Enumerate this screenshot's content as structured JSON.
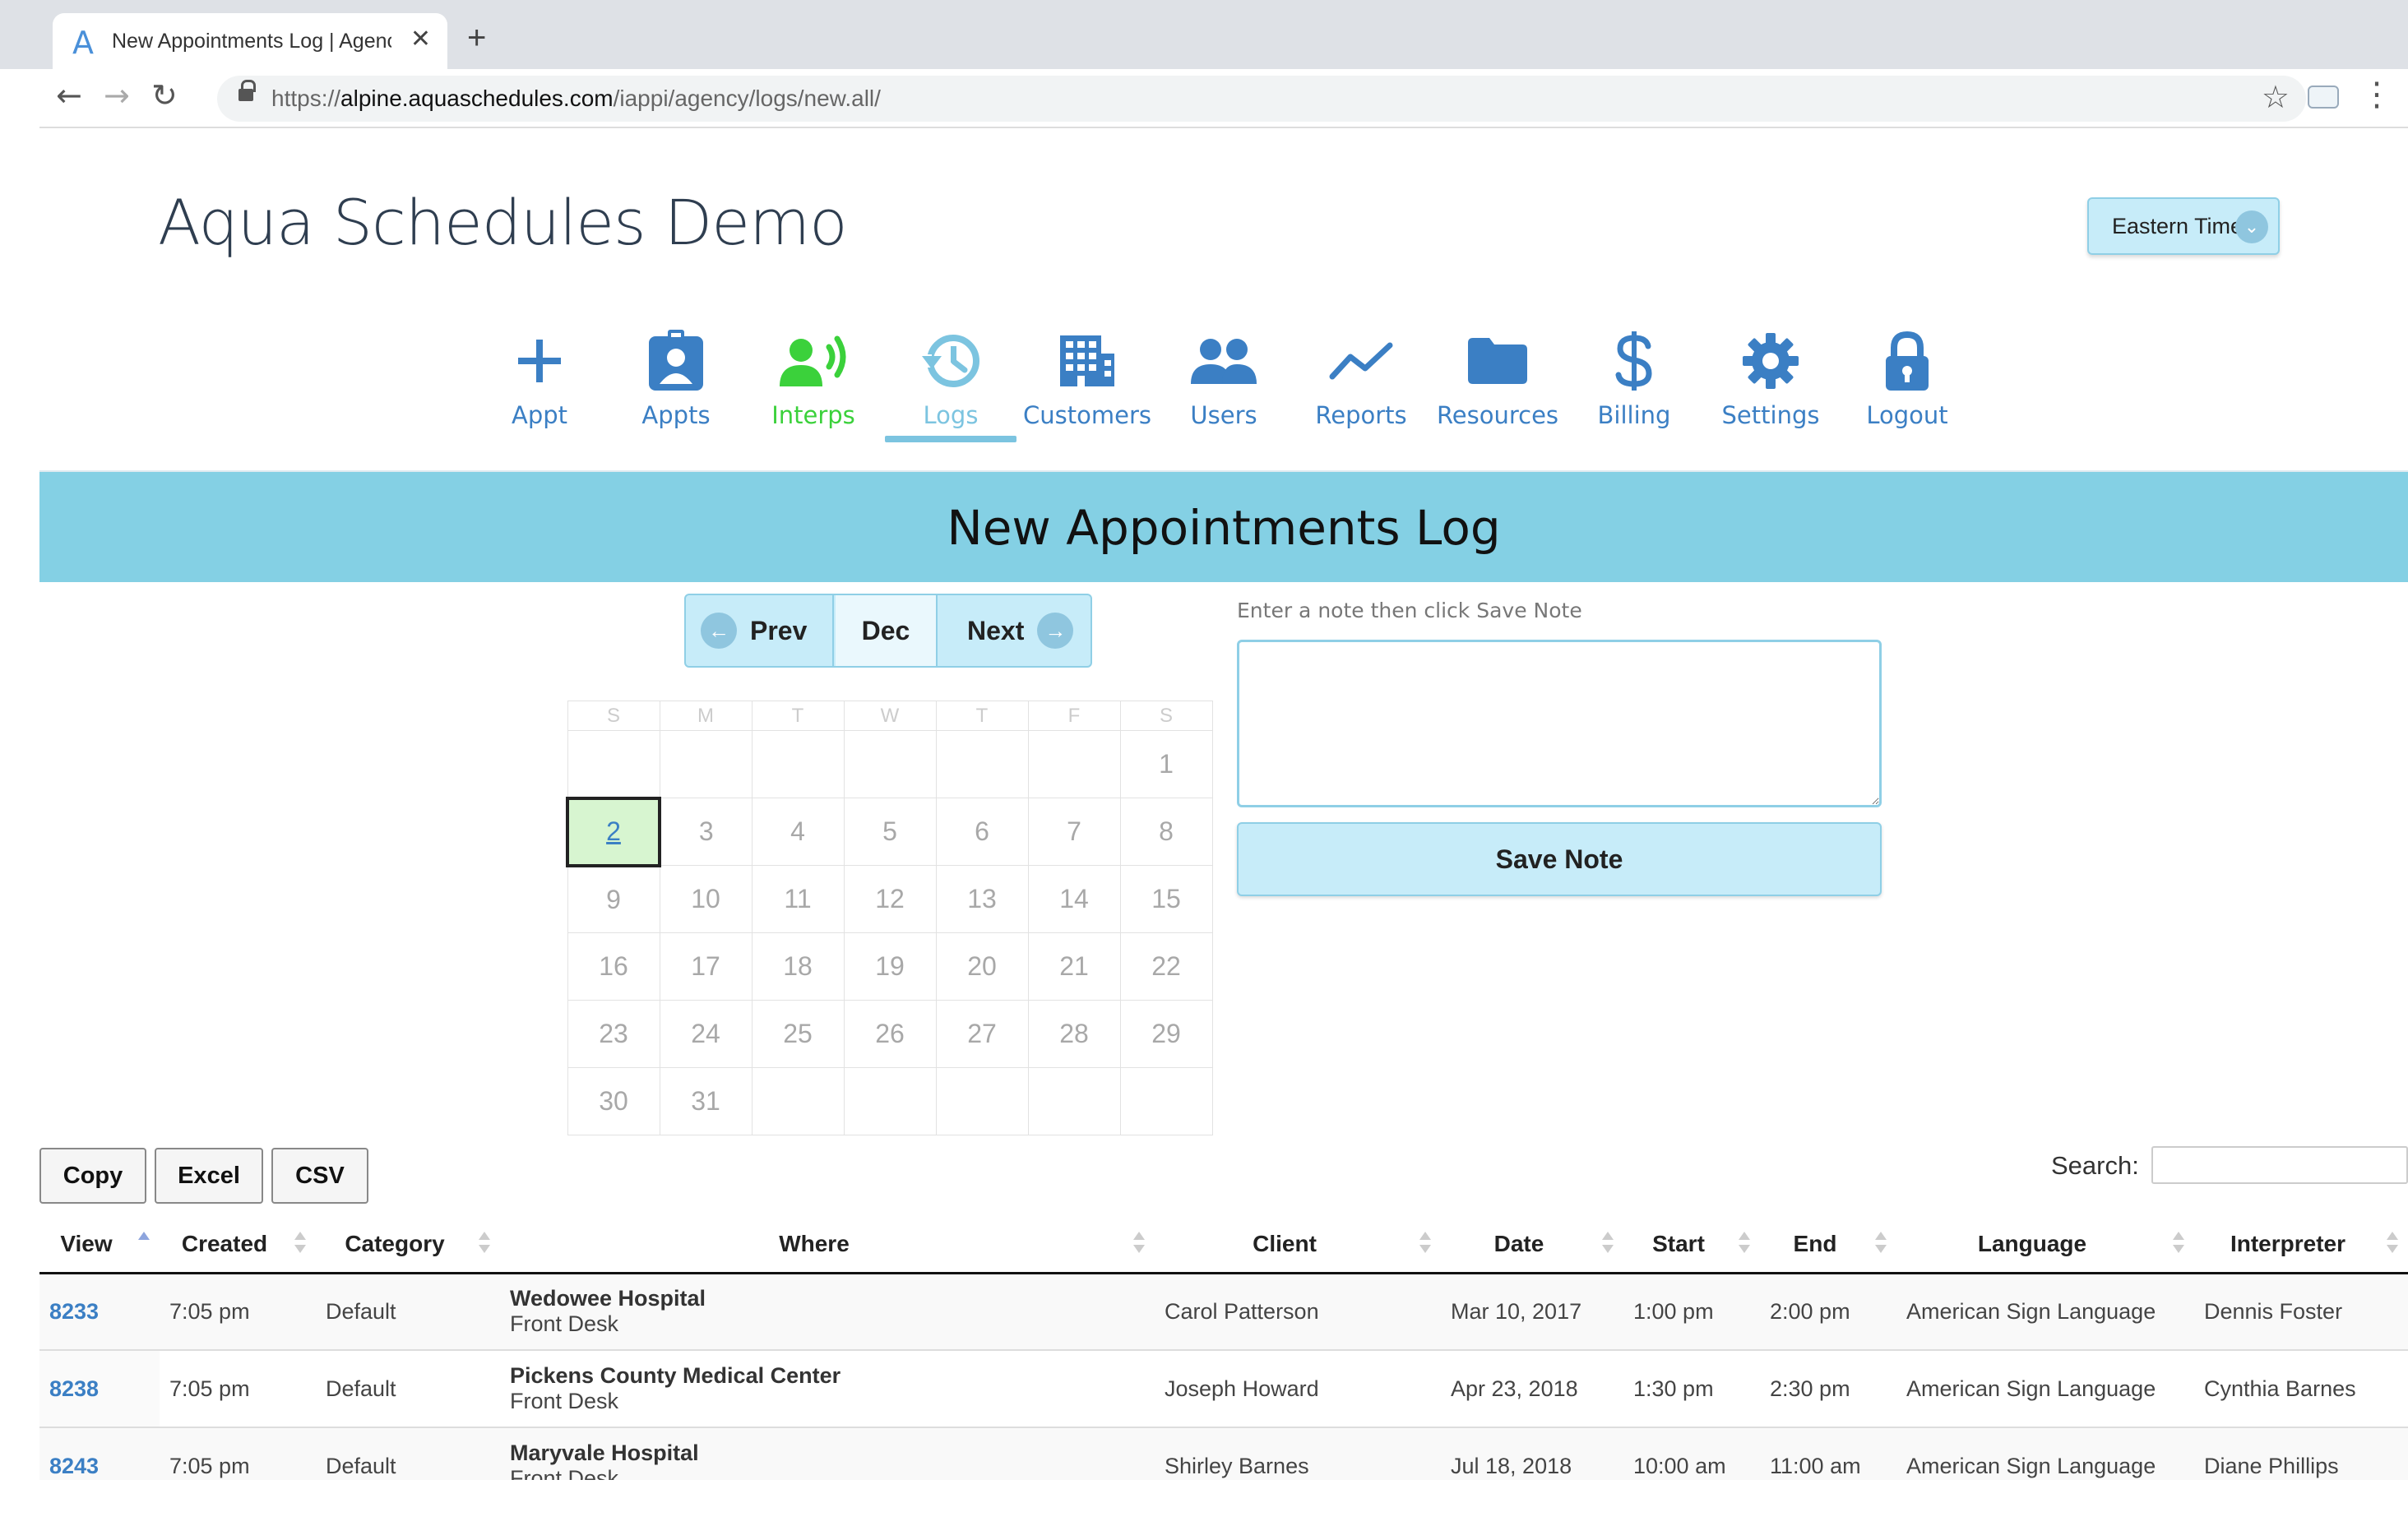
{
  "browser": {
    "tab_title": "New Appointments Log | Agency",
    "favicon": "A",
    "url_scheme": "https://",
    "url_host": "alpine.aquaschedules.com",
    "url_path": "/iappi/agency/logs/new.all/"
  },
  "header": {
    "title": "Aqua Schedules Demo",
    "timezone": "Eastern Time"
  },
  "nav": {
    "items": [
      {
        "label": "Appt",
        "icon": "plus-icon"
      },
      {
        "label": "Appts",
        "icon": "id-badge-icon"
      },
      {
        "label": "Interps",
        "icon": "interpreter-icon"
      },
      {
        "label": "Logs",
        "icon": "history-icon"
      },
      {
        "label": "Customers",
        "icon": "building-icon"
      },
      {
        "label": "Users",
        "icon": "users-icon"
      },
      {
        "label": "Reports",
        "icon": "line-chart-icon"
      },
      {
        "label": "Resources",
        "icon": "folder-icon"
      },
      {
        "label": "Billing",
        "icon": "dollar-icon"
      },
      {
        "label": "Settings",
        "icon": "gear-icon"
      },
      {
        "label": "Logout",
        "icon": "lock-icon"
      }
    ],
    "active": "Logs",
    "colors": {
      "default": "#3b7fc4",
      "interps": "#3bd13b",
      "active": "#7cc4e0"
    }
  },
  "page": {
    "heading": "New Appointments Log",
    "band_color": "#84d0e4"
  },
  "month_nav": {
    "prev": "Prev",
    "month": "Dec",
    "next": "Next"
  },
  "calendar": {
    "weekdays": [
      "S",
      "M",
      "T",
      "W",
      "T",
      "F",
      "S"
    ],
    "weeks": [
      [
        "",
        "",
        "",
        "",
        "",
        "",
        "1"
      ],
      [
        "2",
        "3",
        "4",
        "5",
        "6",
        "7",
        "8"
      ],
      [
        "9",
        "10",
        "11",
        "12",
        "13",
        "14",
        "15"
      ],
      [
        "16",
        "17",
        "18",
        "19",
        "20",
        "21",
        "22"
      ],
      [
        "23",
        "24",
        "25",
        "26",
        "27",
        "28",
        "29"
      ],
      [
        "30",
        "31",
        "",
        "",
        "",
        "",
        ""
      ]
    ],
    "today": "2"
  },
  "note": {
    "label": "Enter a note then click Save Note",
    "value": "",
    "save_label": "Save Note"
  },
  "export": {
    "copy": "Copy",
    "excel": "Excel",
    "csv": "CSV"
  },
  "search": {
    "label": "Search:",
    "value": ""
  },
  "table": {
    "columns": [
      "View",
      "Created",
      "Category",
      "Where",
      "Client",
      "Date",
      "Start",
      "End",
      "Language",
      "Interpreter"
    ],
    "sorted_column": "View",
    "rows": [
      {
        "view": "8233",
        "created": "7:05 pm",
        "category": "Default",
        "where_name": "Wedowee Hospital",
        "where_sub": "Front Desk",
        "client": "Carol Patterson",
        "date": "Mar 10, 2017",
        "start": "1:00 pm",
        "end": "2:00 pm",
        "language": "American Sign Language",
        "interpreter": "Dennis Foster"
      },
      {
        "view": "8238",
        "created": "7:05 pm",
        "category": "Default",
        "where_name": "Pickens County Medical Center",
        "where_sub": "Front Desk",
        "client": "Joseph Howard",
        "date": "Apr 23, 2018",
        "start": "1:30 pm",
        "end": "2:30 pm",
        "language": "American Sign Language",
        "interpreter": "Cynthia Barnes"
      },
      {
        "view": "8243",
        "created": "7:05 pm",
        "category": "Default",
        "where_name": "Maryvale Hospital",
        "where_sub": "Front Desk",
        "client": "Shirley Barnes",
        "date": "Jul 18, 2018",
        "start": "10:00 am",
        "end": "11:00 am",
        "language": "American Sign Language",
        "interpreter": "Diane Phillips"
      }
    ]
  }
}
